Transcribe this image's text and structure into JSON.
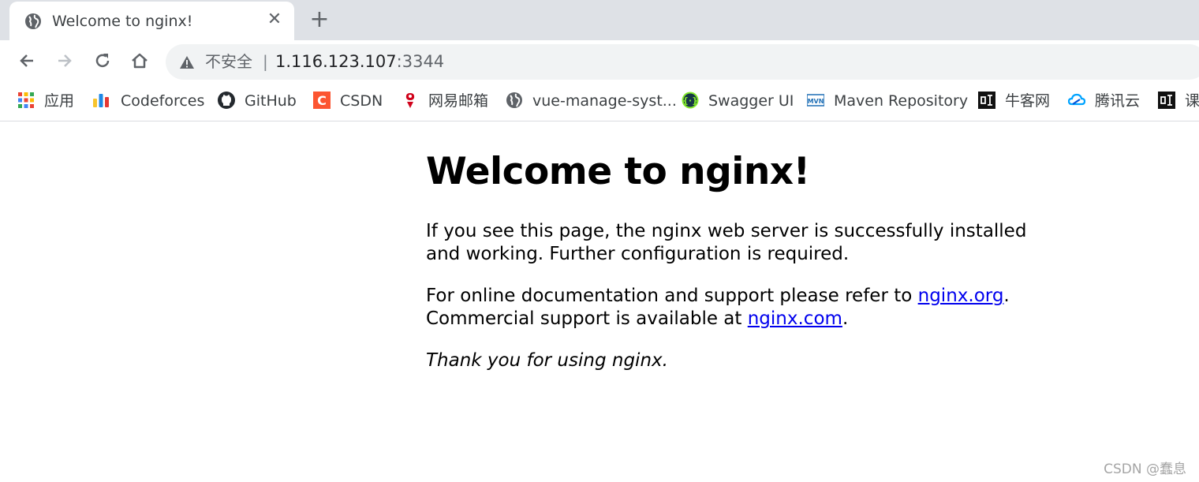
{
  "tab": {
    "title": "Welcome to nginx!",
    "favicon": "globe-icon",
    "close_icon": "close-icon"
  },
  "toolbar": {
    "back_icon": "back-arrow-icon",
    "forward_icon": "forward-arrow-icon",
    "reload_icon": "reload-icon",
    "home_icon": "home-icon"
  },
  "omnibox": {
    "security_label": "不安全",
    "separator": "|",
    "host": "1.116.123.107",
    "port": ":3344"
  },
  "bookmarks": [
    {
      "label": "应用",
      "icon": "apps-grid-icon"
    },
    {
      "label": "Codeforces",
      "icon": "codeforces-icon"
    },
    {
      "label": "GitHub",
      "icon": "github-icon"
    },
    {
      "label": "CSDN",
      "icon": "csdn-icon"
    },
    {
      "label": "网易邮箱",
      "icon": "netease-mail-icon"
    },
    {
      "label": "vue-manage-syst...",
      "icon": "globe-icon"
    },
    {
      "label": "Swagger UI",
      "icon": "swagger-icon"
    },
    {
      "label": "Maven Repository",
      "icon": "maven-icon"
    },
    {
      "label": "牛客网",
      "icon": "nowcoder-icon"
    },
    {
      "label": "腾讯云",
      "icon": "tencent-cloud-icon"
    },
    {
      "label": "课",
      "icon": "course-icon"
    }
  ],
  "page": {
    "heading": "Welcome to nginx!",
    "p1": "If you see this page, the nginx web server is successfully installed and working. Further configuration is required.",
    "p2_text1": "For online documentation and support please refer to ",
    "p2_link1": "nginx.org",
    "p2_text2": ".",
    "p2_text3": "Commercial support is available at ",
    "p2_link2": "nginx.com",
    "p2_text4": ".",
    "p3": "Thank you for using nginx."
  },
  "watermark": "CSDN @蠢息",
  "colors": {
    "link": "#0000ee",
    "tabstrip": "#dee1e6",
    "omnibox": "#f1f3f4"
  }
}
